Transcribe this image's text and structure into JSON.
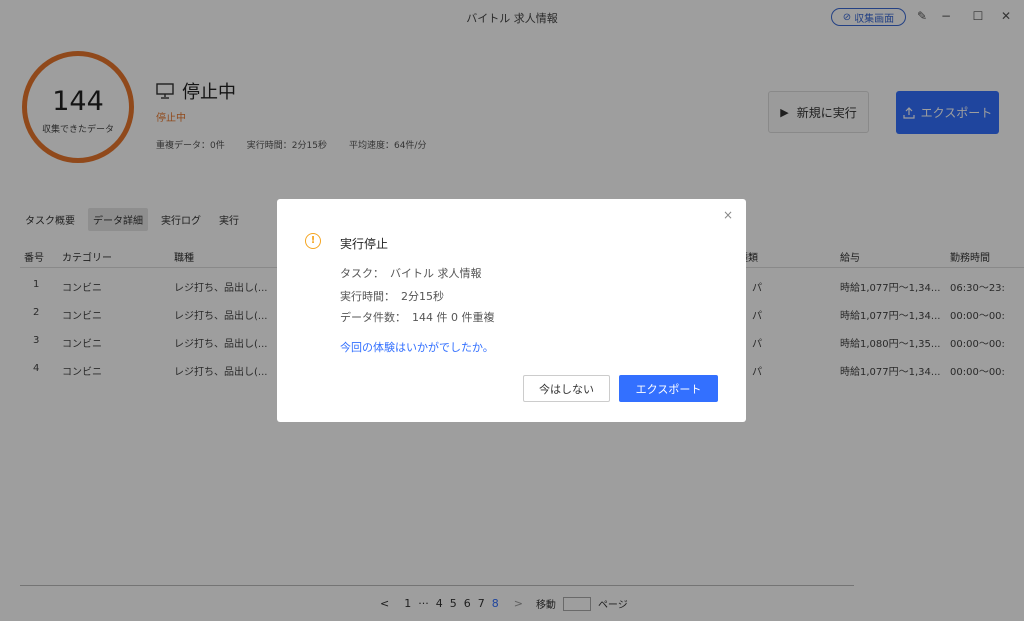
{
  "window": {
    "title": "バイトル 求人情報",
    "collect_screen_label": "収集画面",
    "controls": [
      "edit-icon",
      "minimize-icon",
      "maximize-icon",
      "close-icon"
    ]
  },
  "status": {
    "count": "144",
    "count_label": "収集できたデータ",
    "state": "停止中",
    "state_sub": "停止中",
    "stats": [
      {
        "label": "重複データ：",
        "value": "0件"
      },
      {
        "label": "実行時間：",
        "value": "2分15秒"
      },
      {
        "label": "平均速度：",
        "value": "64件/分"
      }
    ],
    "new_run_label": "新規に実行",
    "export_label": "エクスポート",
    "ring_color": "#e8762c",
    "accent_color": "#3370ff"
  },
  "tabs": [
    {
      "label": "タスク概要",
      "active": false
    },
    {
      "label": "データ詳細",
      "active": true
    },
    {
      "label": "実行ログ",
      "active": false
    },
    {
      "label": "実行",
      "active": false
    }
  ],
  "table": {
    "headers": [
      "番号",
      "カテゴリー",
      "職種",
      "種類",
      "給与",
      "勤務時間"
    ],
    "rows": [
      [
        "1",
        "コンビニ",
        "レジ打ち、品出し(...",
        "パ",
        "時給1,077円〜1,34...",
        "06:30〜23:"
      ],
      [
        "2",
        "コンビニ",
        "レジ打ち、品出し(...",
        "パ",
        "時給1,077円〜1,34...",
        "00:00〜00:"
      ],
      [
        "3",
        "コンビニ",
        "レジ打ち、品出し(...",
        "パ",
        "時給1,080円〜1,35...",
        "00:00〜00:"
      ],
      [
        "4",
        "コンビニ",
        "レジ打ち、品出し(...",
        "パ",
        "時給1,077円〜1,34...",
        "00:00〜00:"
      ]
    ]
  },
  "pager": {
    "prev": "<",
    "pages": [
      "1",
      "···",
      "4",
      "5",
      "6",
      "7",
      "8"
    ],
    "current": "8",
    "next": ">",
    "jump_label": "移動",
    "page_label": "ページ"
  },
  "dialog": {
    "title": "実行停止",
    "lines": [
      {
        "label": "タスク：",
        "value": "バイトル 求人情報"
      },
      {
        "label": "実行時間：",
        "value": "2分15秒"
      },
      {
        "label": "データ件数：",
        "value": "144 件 0 件重複"
      }
    ],
    "feedback_link": "今回の体験はいかがでしたか。",
    "later_label": "今はしない",
    "export_label": "エクスポート",
    "close_symbol": "×",
    "warn_symbol": "!"
  }
}
